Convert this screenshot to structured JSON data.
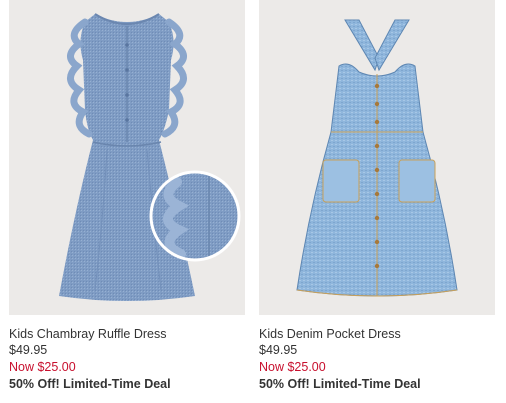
{
  "products": [
    {
      "name": "Kids Chambray Ruffle Dress",
      "original_price": "$49.95",
      "sale_price": "Now $25.00",
      "promo": "50% Off! Limited-Time Deal",
      "image": "chambray-ruffle-dress-image"
    },
    {
      "name": "Kids Denim Pocket Dress",
      "original_price": "$49.95",
      "sale_price": "Now $25.00",
      "promo": "50% Off! Limited-Time Deal",
      "image": "denim-pocket-dress-image"
    }
  ],
  "colors": {
    "sale_red": "#c8102e",
    "text": "#333333",
    "image_bg": "#eceae8"
  }
}
